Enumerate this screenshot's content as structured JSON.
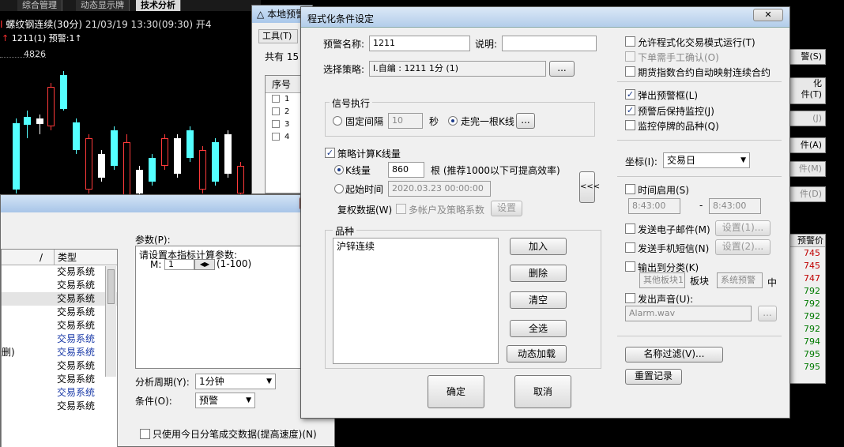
{
  "chart": {
    "tabs": [
      "综合管理",
      "动态显示牌",
      "技术分析"
    ],
    "title_prefix": "Ⅰ",
    "stock_name": "螺纹钢连续(30分)",
    "datetime": "21/03/19 13:30(09:30)",
    "open_label": "开4",
    "sub_arrow": "↑",
    "sub_text": "1211(1) 预警:1↑",
    "price_label": "4826"
  },
  "bg_alert": {
    "title": "本地预警",
    "tools": "工具(T)",
    "count": "共有 15",
    "seq_header": "序号",
    "rows": [
      "1",
      "2",
      "3",
      "4"
    ]
  },
  "bg_right": {
    "buttons": [
      "警(S)",
      "化\n件(T)",
      "(J)",
      "件(A)",
      "件(M)",
      "件(D)"
    ],
    "list_header": "预警价",
    "list_values": [
      "745",
      "745",
      "747",
      "792",
      "792",
      "792",
      "792",
      "794",
      "795",
      "795"
    ]
  },
  "bg_formula": {
    "close_label": "✕",
    "col_slash": "/",
    "col_type": "类型",
    "list_types": [
      "交易系统",
      "交易系统",
      "交易系统",
      "交易系统",
      "交易系统",
      "交易系统",
      "交易系统",
      "交易系统",
      "交易系统",
      "交易系统",
      "交易系统"
    ],
    "partial_item": "删)",
    "param_label": "参数(P):",
    "param_prompt": "请设置本指标计算参数:",
    "param_name": "M:",
    "param_value": "1",
    "param_range": "(1-100)",
    "period_label": "分析周期(Y):",
    "period_value": "1分钟",
    "cond_label": "条件(O):",
    "cond_value": "预警",
    "today_only_label": "只使用今日分笔成交数据(提高速度)(N)"
  },
  "dialog": {
    "title": "程式化条件设定",
    "close_label": "✕",
    "alert_name_label": "预警名称:",
    "alert_name_value": "1211",
    "desc_label": "说明:",
    "desc_value": "",
    "strategy_label": "选择策略:",
    "strategy_value": "I.自编 : 1211 1分 (1)",
    "browse_label": "...",
    "signal_group": "信号执行",
    "fixed_interval_label": "固定间隔",
    "fixed_interval_value": "10",
    "seconds_label": "秒",
    "walk_bar_label": "走完一根K线",
    "strategy_calc_label": "策略计算K线量",
    "kline_label": "K线量",
    "kline_value": "860",
    "kline_hint": "根 (推荐1000以下可提高效率)",
    "start_time_label": "起始时间",
    "start_time_value": "2020.03.23 00:00:00",
    "rights_label": "复权数据(W)",
    "multi_account_label": "多帐户及策略系数",
    "set_label": "设置",
    "variety_group": "品种",
    "varieties": [
      "沪锌连续"
    ],
    "add_label": "加入",
    "delete_label": "删除",
    "clear_label": "清空",
    "select_all_label": "全选",
    "dynamic_load_label": "动态加载",
    "collapse_label": "<<<",
    "ok_label": "确定",
    "cancel_label": "取消",
    "allow_prog_label": "允许程式化交易模式运行(T)",
    "manual_confirm_label": "下单需手工确认(O)",
    "index_map_label": "期货指数合约自动映射连续合约",
    "popup_label": "弹出预警框(L)",
    "keep_monitor_label": "预警后保持监控(J)",
    "monitor_suspended_label": "监控停牌的品种(Q)",
    "axis_label": "坐标(I):",
    "axis_value": "交易日",
    "time_enable_label": "时间启用(S)",
    "time_from": "8:43:00",
    "time_dash": "-",
    "time_to": "8:43:00",
    "email_label": "发送电子邮件(M)",
    "email_setting": "设置(1)...",
    "sms_label": "发送手机短信(N)",
    "sms_setting": "设置(2)...",
    "output_class_label": "输出到分类(K)",
    "other_block": "其他板块1",
    "block_label": "板块",
    "system_alert": "系统预警",
    "in_label": "中",
    "sound_label": "发出声音(U):",
    "sound_file": "Alarm.wav",
    "name_filter_label": "名称过滤(V)...",
    "reset_record_label": "重置记录"
  }
}
